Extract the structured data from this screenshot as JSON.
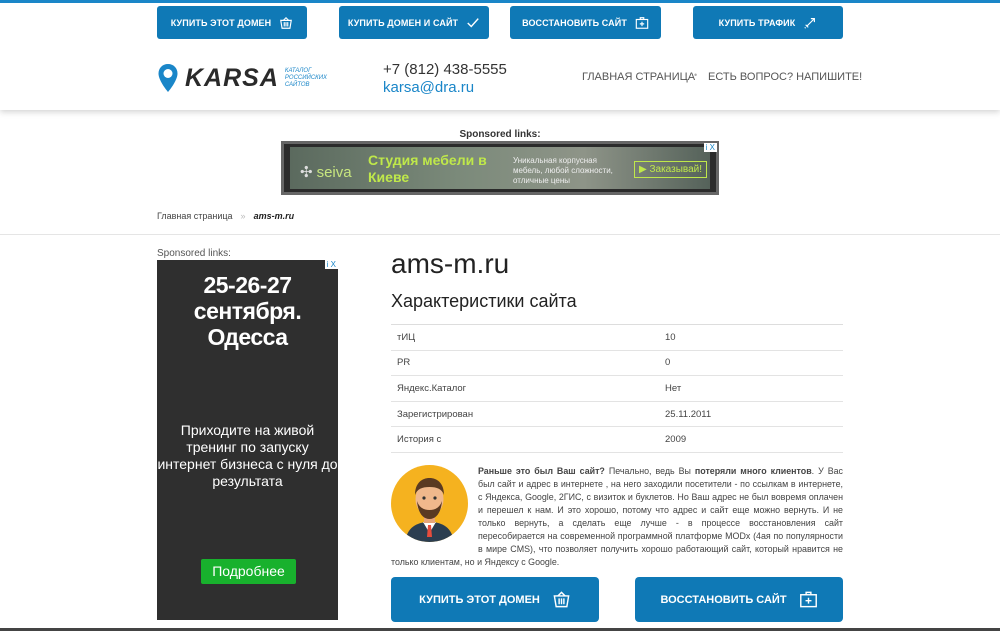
{
  "top_buttons": [
    {
      "label": "КУПИТЬ ЭТОТ ДОМЕН",
      "icon": "basket-icon"
    },
    {
      "label": "КУПИТЬ ДОМЕН И САЙТ",
      "icon": "checkmark-icon"
    },
    {
      "label": "ВОССТАНОВИТЬ САЙТ",
      "icon": "medkit-icon"
    },
    {
      "label": "КУПИТЬ ТРАФИК",
      "icon": "rocket-icon"
    }
  ],
  "logo": {
    "name": "KARSA",
    "subtitle": "КАТАЛОГ РОССИЙСКИХ САЙТОВ"
  },
  "contacts": {
    "phone": "+7 (812) 438-5555",
    "email": "karsa@dra.ru"
  },
  "nav": {
    "home": "ГЛАВНАЯ СТРАНИЦА",
    "dot": "•",
    "ask": "ЕСТЬ ВОПРОС? НАПИШИТЕ!"
  },
  "sponsored_top": "Sponsored links:",
  "top_ad": {
    "brand": "seiva",
    "title": "Студия мебели в Киеве",
    "desc": "Уникальная корпусная мебель, любой сложности, отличные цены",
    "cta": "Заказывай!",
    "adchoice": "i X"
  },
  "breadcrumb": {
    "home": "Главная страница",
    "sep": "»",
    "current": "ams-m.ru"
  },
  "side_ad": {
    "label": "Sponsored links:",
    "dates": "25-26-27 сентября. Одесса",
    "desc": "Приходите на живой тренинг по запуску интернет бизнеса с нуля до результата",
    "more": "Подробнее",
    "adchoice": "i X"
  },
  "site": {
    "domain": "ams-m.ru",
    "subtitle": "Характеристики сайта",
    "stats": [
      {
        "label": "тИЦ",
        "value": "10"
      },
      {
        "label": "PR",
        "value": "0"
      },
      {
        "label": "Яндекс.Каталог",
        "value": "Нет"
      },
      {
        "label": "Зарегистрирован",
        "value": "25.11.2011"
      },
      {
        "label": "История с",
        "value": "2009"
      }
    ]
  },
  "story": {
    "q": "Раньше это был Ваш сайт?",
    "t1": " Печально, ведь Вы ",
    "b1": "потеряли много клиентов",
    "t2": ". У Вас был сайт и адрес в интернете , на него заходили посетители - по ссылкам в интернете, с Яндекса, Google, 2ГИС, с визиток и буклетов. Но Ваш адрес не был вовремя оплачен и перешел к нам. И это хорошо, потому что адрес и сайт еще можно вернуть. И не только вернуть, а сделать еще лучше - в процессе восстановления сайт пересобирается на современной программной платформе MODx (4ая по популярности в мире CMS), что позволяет получить хорошо работающий сайт, который нравится не только клиентам, но и Яндексу с Google."
  },
  "bottom_buttons": [
    {
      "label": "КУПИТЬ ЭТОТ ДОМЕН",
      "icon": "basket-icon"
    },
    {
      "label": "ВОССТАНОВИТЬ САЙТ",
      "icon": "medkit-icon"
    }
  ],
  "colors": {
    "primary": "#0f79b6",
    "accent": "#1a86c8",
    "ad_green": "#18b12d",
    "avatar_bg": "#f5b21f"
  }
}
